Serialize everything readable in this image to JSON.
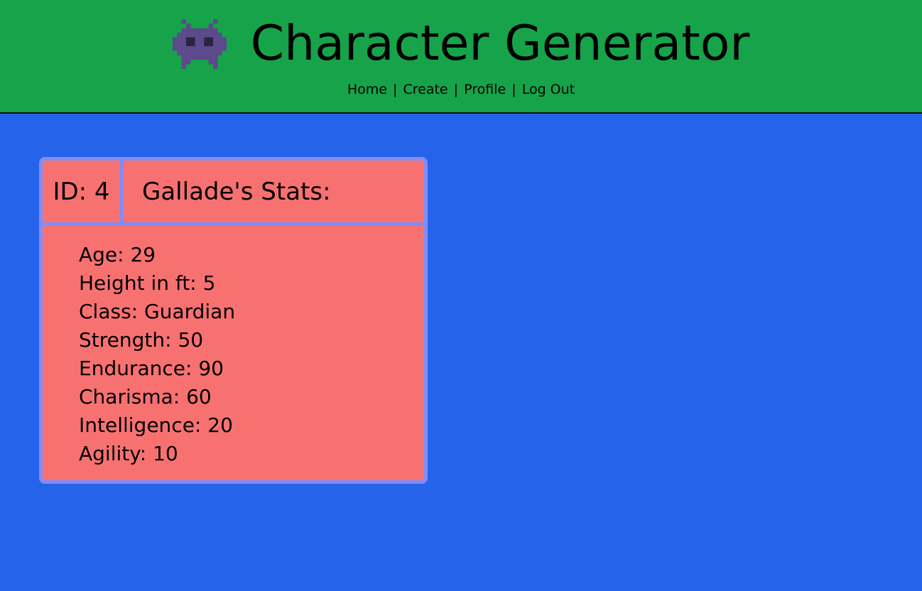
{
  "header": {
    "logo_icon": "alien-monster-icon",
    "title": "Character Generator",
    "nav": [
      {
        "label": "Home"
      },
      {
        "label": "Create"
      },
      {
        "label": "Profile"
      },
      {
        "label": "Log Out"
      }
    ],
    "separator": "|"
  },
  "character": {
    "id_label": "ID: 4",
    "name_label": "Gallade's Stats:",
    "stats": [
      {
        "label": "Age: 29"
      },
      {
        "label": "Height in ft: 5"
      },
      {
        "label": "Class: Guardian"
      },
      {
        "label": "Strength: 50"
      },
      {
        "label": "Endurance: 90"
      },
      {
        "label": "Charisma: 60"
      },
      {
        "label": "Intelligence: 20"
      },
      {
        "label": "Agility: 10"
      }
    ]
  },
  "colors": {
    "header_bg": "#16a34a",
    "page_bg": "#2563eb",
    "card_bg": "#f87171",
    "card_border": "#818cf8",
    "logo": "#5b4a8c"
  }
}
